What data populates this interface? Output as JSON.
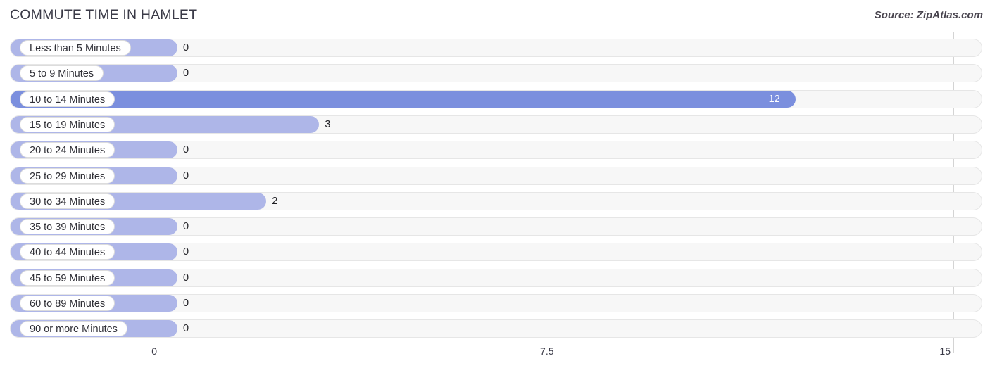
{
  "header": {
    "title": "COMMUTE TIME IN HAMLET",
    "source": "Source: ZipAtlas.com"
  },
  "colors": {
    "bar_normal": "#aeb6e8",
    "bar_highlight": "#7b8fde",
    "track": "#f7f7f7",
    "gridline": "#d4d4d4",
    "title_text": "#3a3a47"
  },
  "chart_data": {
    "type": "bar",
    "orientation": "horizontal",
    "title": "COMMUTE TIME IN HAMLET",
    "xlabel": "",
    "ylabel": "",
    "xlim": [
      0,
      15
    ],
    "xticks": [
      "0",
      "7.5",
      "15"
    ],
    "xtick_values": [
      0,
      7.5,
      15
    ],
    "grid": true,
    "legend": "none",
    "categories": [
      "Less than 5 Minutes",
      "5 to 9 Minutes",
      "10 to 14 Minutes",
      "15 to 19 Minutes",
      "20 to 24 Minutes",
      "25 to 29 Minutes",
      "30 to 34 Minutes",
      "35 to 39 Minutes",
      "40 to 44 Minutes",
      "45 to 59 Minutes",
      "60 to 89 Minutes",
      "90 or more Minutes"
    ],
    "values": [
      0,
      0,
      12,
      3,
      0,
      0,
      2,
      0,
      0,
      0,
      0,
      0
    ],
    "value_labels": [
      "0",
      "0",
      "12",
      "3",
      "0",
      "0",
      "2",
      "0",
      "0",
      "0",
      "0",
      "0"
    ],
    "highlight_index": 2
  },
  "rows": [
    {
      "label": "Less than 5 Minutes",
      "value": 0,
      "value_label": "0",
      "highlight": false
    },
    {
      "label": "5 to 9 Minutes",
      "value": 0,
      "value_label": "0",
      "highlight": false
    },
    {
      "label": "10 to 14 Minutes",
      "value": 12,
      "value_label": "12",
      "highlight": true
    },
    {
      "label": "15 to 19 Minutes",
      "value": 3,
      "value_label": "3",
      "highlight": false
    },
    {
      "label": "20 to 24 Minutes",
      "value": 0,
      "value_label": "0",
      "highlight": false
    },
    {
      "label": "25 to 29 Minutes",
      "value": 0,
      "value_label": "0",
      "highlight": false
    },
    {
      "label": "30 to 34 Minutes",
      "value": 2,
      "value_label": "2",
      "highlight": false
    },
    {
      "label": "35 to 39 Minutes",
      "value": 0,
      "value_label": "0",
      "highlight": false
    },
    {
      "label": "40 to 44 Minutes",
      "value": 0,
      "value_label": "0",
      "highlight": false
    },
    {
      "label": "45 to 59 Minutes",
      "value": 0,
      "value_label": "0",
      "highlight": false
    },
    {
      "label": "60 to 89 Minutes",
      "value": 0,
      "value_label": "0",
      "highlight": false
    },
    {
      "label": "90 or more Minutes",
      "value": 0,
      "value_label": "0",
      "highlight": false
    }
  ],
  "axis": {
    "ticks": [
      {
        "label": "0",
        "value": 0
      },
      {
        "label": "7.5",
        "value": 7.5
      },
      {
        "label": "15",
        "value": 15
      }
    ]
  }
}
